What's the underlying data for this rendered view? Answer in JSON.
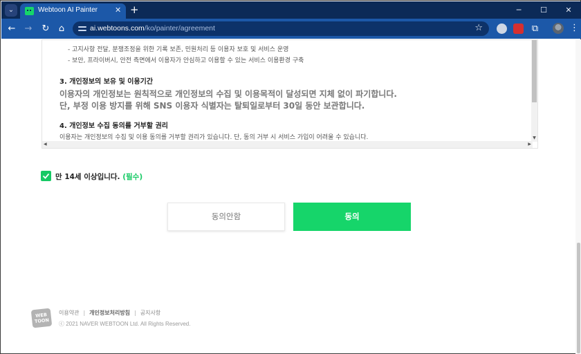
{
  "browser": {
    "tab_title": "Webtoon AI Painter",
    "url_host": "ai.webtoons.com",
    "url_path": "/ko/painter/agreement"
  },
  "icons": {
    "tab_search": "chevron-down-icon",
    "close": "close-icon",
    "new_tab": "plus-icon",
    "back": "arrow-left-icon",
    "forward": "arrow-right-icon",
    "reload": "reload-icon",
    "home": "home-icon",
    "bookmark": "star-icon",
    "extensions": "puzzle-icon",
    "menu": "more-vert-icon"
  },
  "terms": {
    "line1": "- 고지사항 전달, 분쟁조정을 위한 기록 보존, 민원처리 등 이용자 보호 및 서비스 운영",
    "line2": "- 보안, 프라이버시, 안전 측면에서 이용자가 안심하고 이용할 수 있는 서비스 이용환경 구축",
    "section3_title": "3. 개인정보의 보유 및 이용기간",
    "section3_body1": "이용자의 개인정보는 원칙적으로 개인정보의 수집 및 이용목적이 달성되면 지체 없이 파기합니다.",
    "section3_body2": "단, 부정 이용 방지를 위해 SNS 이용자 식별자는 탈퇴일로부터 30일 동안 보관합니다.",
    "section4_title": "4. 개인정보 수집 동의를 거부할 권리",
    "section4_body": "이용자는 개인정보의 수집 및 이용 동의를 거부할 권리가 있습니다. 단, 동의 거부 시 서비스 가입이 어려울 수 있습니다."
  },
  "age": {
    "label": "만 14세 이상입니다.",
    "required": "(필수)",
    "checked": true
  },
  "buttons": {
    "disagree": "동의안함",
    "agree": "동의"
  },
  "footer": {
    "logo_line1": "WEB",
    "logo_line2": "TOON",
    "terms_link": "이용약관",
    "privacy_link": "개인정보처리방침",
    "notice_link": "공지사항",
    "separator": "|",
    "copyright": "ⓒ 2021 NAVER WEBTOON Ltd. All Rights Reserved."
  },
  "colors": {
    "accent_green": "#16d56a",
    "browser_blue": "#1c58a8",
    "tabstrip_navy": "#0c2a57"
  }
}
